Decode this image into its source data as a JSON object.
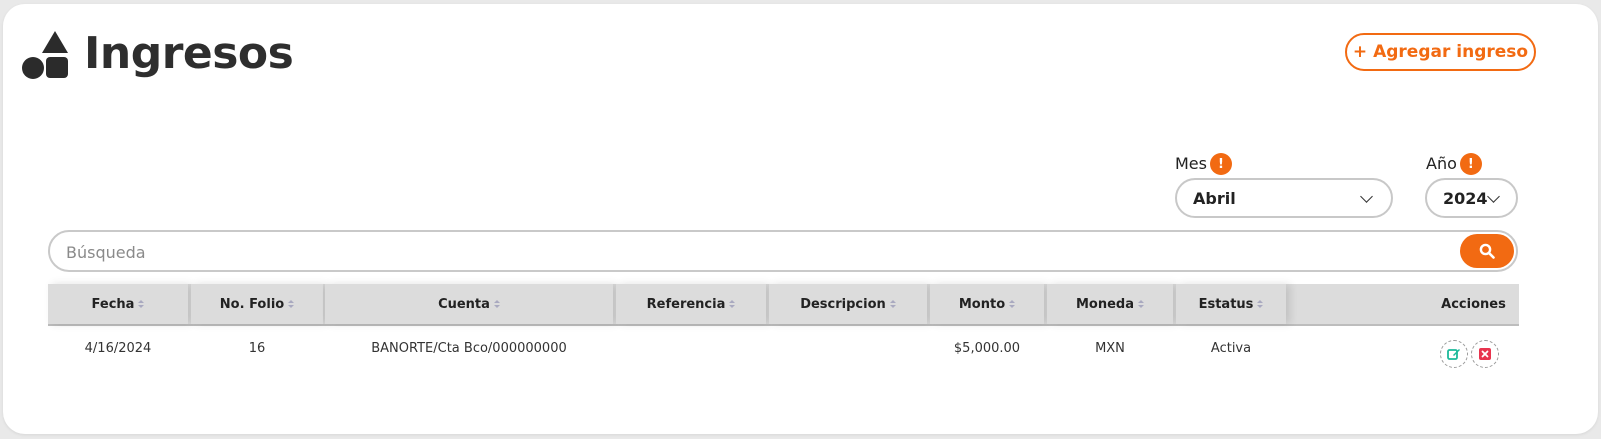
{
  "header": {
    "title": "Ingresos",
    "logo_icon": "shapes-icon"
  },
  "actions": {
    "add_label": "+ Agregar ingreso"
  },
  "filters": {
    "month": {
      "label": "Mes",
      "value": "Abril"
    },
    "year": {
      "label": "Año",
      "value": "2024"
    }
  },
  "search": {
    "placeholder": "Búsqueda"
  },
  "colors": {
    "accent": "#f26a12",
    "header_bg": "#dcdcdc",
    "edit": "#1bb99a",
    "delete": "#e8344e"
  },
  "table": {
    "columns": [
      "Fecha",
      "No. Folio",
      "Cuenta",
      "Referencia",
      "Descripcion",
      "Monto",
      "Moneda",
      "Estatus",
      "Acciones"
    ],
    "rows": [
      {
        "fecha": "4/16/2024",
        "folio": "16",
        "cuenta": "BANORTE/Cta Bco/000000000",
        "referencia": "",
        "descripcion": "",
        "monto": "$5,000.00",
        "moneda": "MXN",
        "estatus": "Activa"
      }
    ]
  }
}
